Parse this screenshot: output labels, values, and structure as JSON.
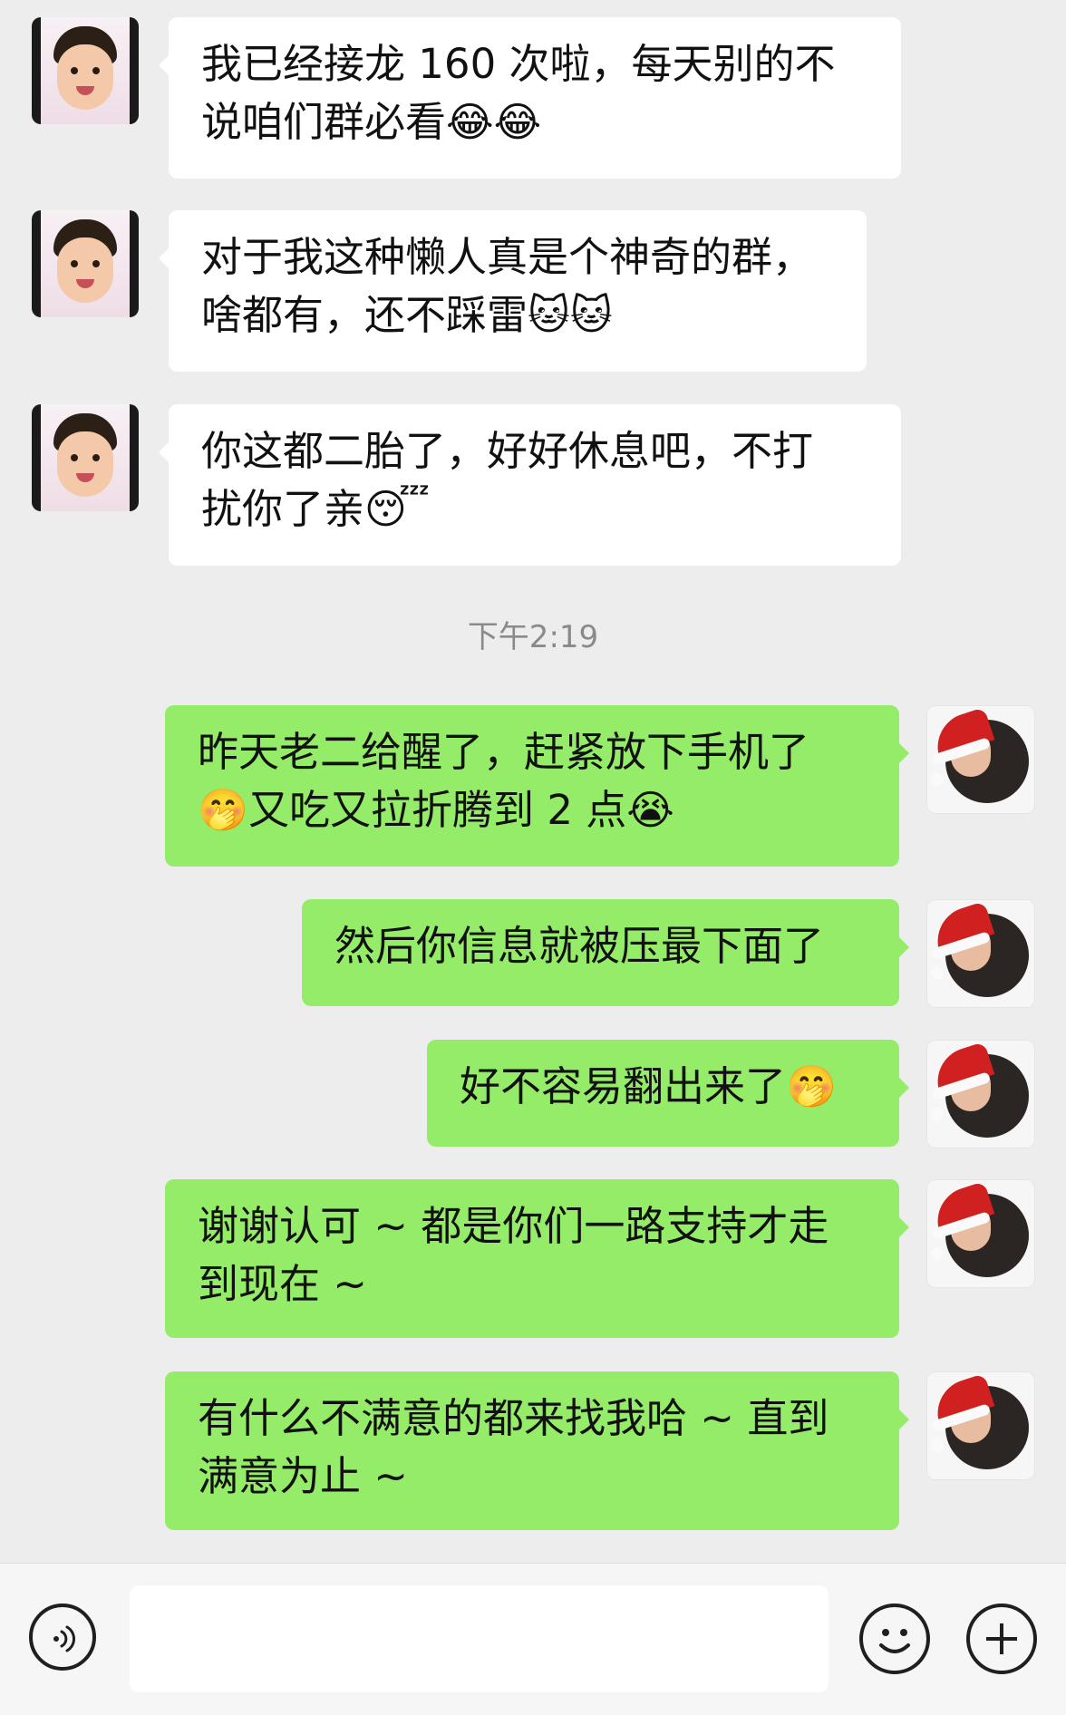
{
  "chat": {
    "timestamp": "下午2:19",
    "messages": [
      {
        "side": "left",
        "text": "我已经接龙 160 次啦，每天别的不\n说咱们群必看😂😂"
      },
      {
        "side": "left",
        "text": "对于我这种懒人真是个神奇的群，\n啥都有，还不踩雷🐱🐱"
      },
      {
        "side": "left",
        "text": "你这都二胎了，好好休息吧，不打\n扰你了亲😴"
      },
      {
        "side": "right",
        "text": "昨天老二给醒了，赶紧放下手机了\n🤭又吃又拉折腾到 2 点😭"
      },
      {
        "side": "right",
        "text": "然后你信息就被压最下面了"
      },
      {
        "side": "right",
        "text": "好不容易翻出来了🤭"
      },
      {
        "side": "right",
        "text": "谢谢认可 ~ 都是你们一路支持才走\n到现在 ~"
      },
      {
        "side": "right",
        "text": "有什么不满意的都来找我哈 ~ 直到\n满意为止 ~"
      }
    ]
  },
  "input_bar": {
    "value": "",
    "voice_icon": "voice-icon",
    "emoji_icon": "emoji-icon",
    "plus_icon": "plus-icon"
  }
}
